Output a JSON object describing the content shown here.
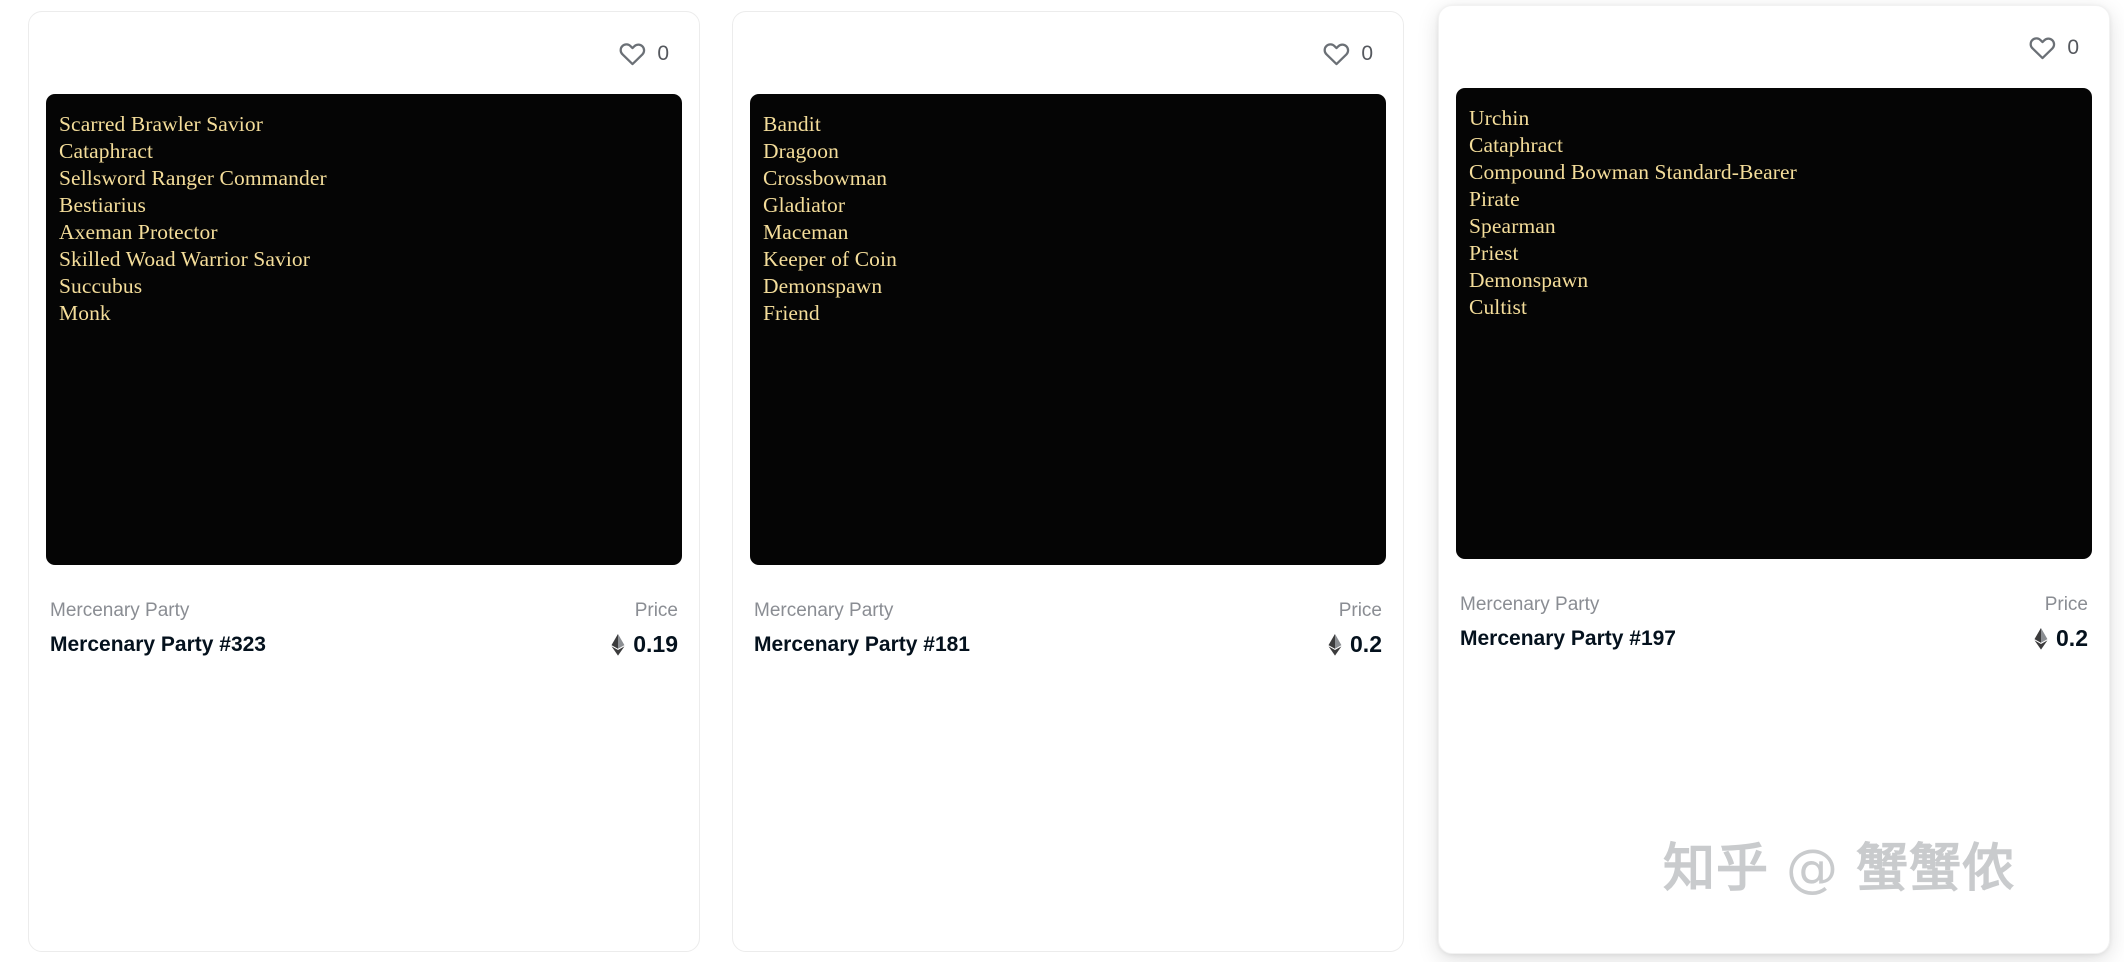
{
  "page": {
    "background": "#ffffff",
    "accent_gold": "#f4dd9a",
    "art_background": "#050505",
    "text_dark": "#04111d",
    "text_muted": "#8a8d93"
  },
  "watermark": {
    "logo": "知乎",
    "at": "@",
    "handle": "蟹蟹侬"
  },
  "cards": [
    {
      "like_icon": "heart-outline-icon",
      "like_count": "0",
      "traits": [
        "Scarred Brawler Savior",
        "Cataphract",
        "Sellsword Ranger Commander",
        "Bestiarius",
        "Axeman Protector",
        "Skilled Woad Warrior Savior",
        "Succubus",
        "Monk"
      ],
      "collection": "Mercenary Party",
      "name": "Mercenary Party #323",
      "price_label": "Price",
      "currency_icon": "ethereum-icon",
      "price": "0.19",
      "elevated": false
    },
    {
      "like_icon": "heart-outline-icon",
      "like_count": "0",
      "traits": [
        "Bandit",
        "Dragoon",
        "Crossbowman",
        "Gladiator",
        "Maceman",
        "Keeper of Coin",
        "Demonspawn",
        "Friend"
      ],
      "collection": "Mercenary Party",
      "name": "Mercenary Party #181",
      "price_label": "Price",
      "currency_icon": "ethereum-icon",
      "price": "0.2",
      "elevated": false
    },
    {
      "like_icon": "heart-outline-icon",
      "like_count": "0",
      "traits": [
        "Urchin",
        "Cataphract",
        "Compound Bowman Standard-Bearer",
        "Pirate",
        "Spearman",
        "Priest",
        "Demonspawn",
        "Cultist"
      ],
      "collection": "Mercenary Party",
      "name": "Mercenary Party #197",
      "price_label": "Price",
      "currency_icon": "ethereum-icon",
      "price": "0.2",
      "elevated": true
    }
  ]
}
